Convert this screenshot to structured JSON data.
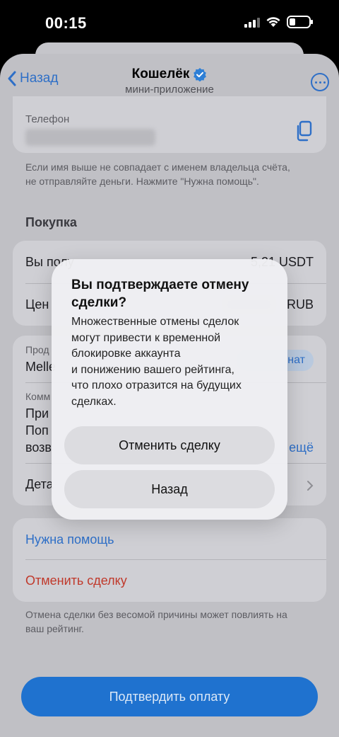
{
  "status_bar": {
    "time": "00:15"
  },
  "nav": {
    "back_label": "Назад",
    "title": "Кошелёк",
    "subtitle": "мини-приложение"
  },
  "phone": {
    "label": "Телефон"
  },
  "name_note": "Если имя выше не совпадает с именем владельца счёта, не отправляйте деньги. Нажмите \"Нужна помощь\".",
  "purchase": {
    "section_title": "Покупка",
    "row1_label": "Вы полу",
    "row1_value": "5,21 USDT",
    "row2_label": "Цен",
    "row2_value": "RUB"
  },
  "seller": {
    "label": "Прод",
    "name": "Melle",
    "badge": "нат",
    "comment_label": "Комм",
    "comment_line1": "При",
    "comment_line2": "Поп",
    "comment_line3": "возв",
    "more_link": "ещё",
    "details_label": "Дета"
  },
  "actions": {
    "help": "Нужна помощь",
    "cancel": "Отменить сделку",
    "cancel_note": "Отмена сделки без весомой причины может повлиять на ваш рейтинг."
  },
  "confirm_button": "Подтвердить оплату",
  "alert": {
    "title": "Вы подтверждаете отмену сделки?",
    "message": "Множественные отмены сделок\nмогут привести к временной\nблокировке аккаунта\nи понижению вашего рейтинга,\nчто плохо отразится на будущих\nсделках.",
    "cancel_deal_button": "Отменить сделку",
    "back_button": "Назад"
  },
  "colors": {
    "accent": "#2e6fc7",
    "danger": "#c0392b",
    "primary_button": "#1f72cf"
  }
}
